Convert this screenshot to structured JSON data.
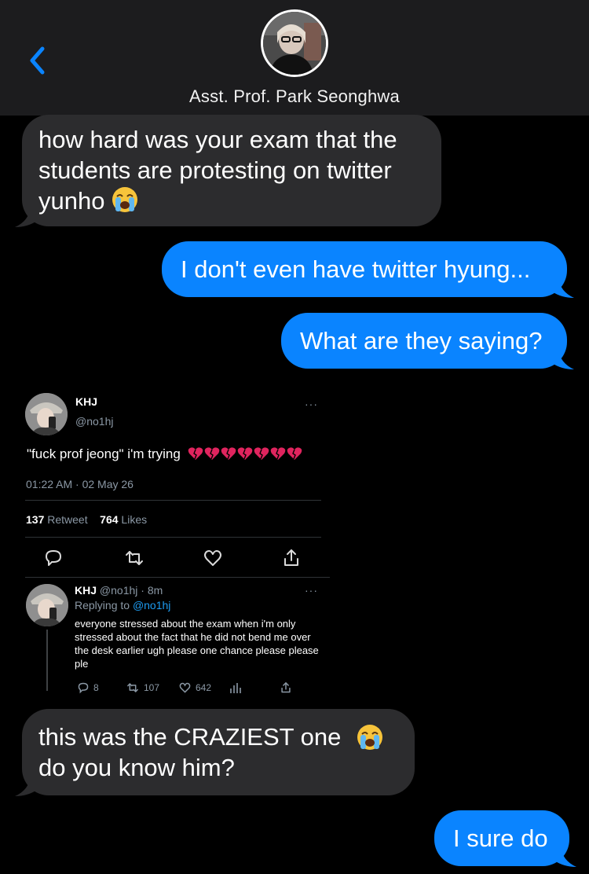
{
  "header": {
    "contact_name": "Asst. Prof. Park Seonghwa",
    "back_icon": "chevron-left-icon",
    "accent_color": "#0a84ff"
  },
  "messages": [
    {
      "direction": "incoming",
      "text": "how hard was your exam that the\nstudents are protesting on twitter\nyunho",
      "emoji": "loudly-crying-face"
    },
    {
      "direction": "outgoing",
      "text": "I don't even have twitter hyung..."
    },
    {
      "direction": "outgoing",
      "text": "What are they saying?"
    },
    {
      "direction": "incoming",
      "text": "this was the CRAZIEST one\ndo you know him?",
      "emoji": "loudly-crying-face"
    },
    {
      "direction": "outgoing",
      "text": "I sure do"
    }
  ],
  "tweet": {
    "name": "KHJ",
    "handle": "@no1hj",
    "more": "···",
    "text": "\"fuck prof jeong\" i'm trying",
    "emoji": "broken-heart x7",
    "time": "01:22 AM · 02 May 26",
    "retweet_count": "137",
    "retweet_label": "Retweet",
    "like_count": "764",
    "like_label": "Likes",
    "reply": {
      "name": "KHJ",
      "handle_time": "@no1hj · 8m",
      "replying_prefix": "Replying to",
      "replying_handle": "@no1hj",
      "text": "everyone stressed about the exam when i'm only stressed about the fact that he did not bend me over the desk earlier ugh please one chance please please ple",
      "reply_count": "8",
      "retweet_count": "107",
      "like_count": "642"
    }
  }
}
